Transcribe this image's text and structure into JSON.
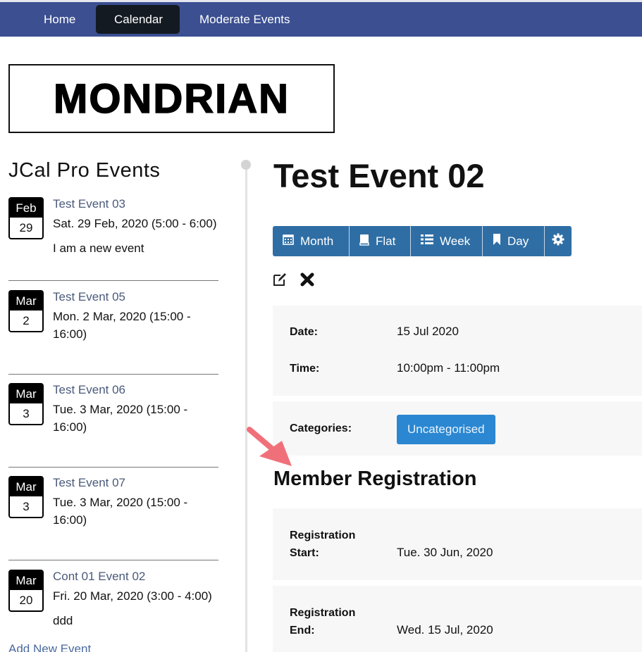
{
  "nav": {
    "items": [
      {
        "label": "Home",
        "active": false
      },
      {
        "label": "Calendar",
        "active": true
      },
      {
        "label": "Moderate Events",
        "active": false
      }
    ]
  },
  "logo": {
    "text": "MONDRIAN"
  },
  "sidebar": {
    "title": "JCal Pro Events",
    "events": [
      {
        "month": "Feb",
        "day": "29",
        "title": "Test Event 03",
        "when": "Sat. 29 Feb, 2020 (5:00 - 6:00)",
        "description": "I am a new event"
      },
      {
        "month": "Mar",
        "day": "2",
        "title": "Test Event 05",
        "when": "Mon. 2 Mar, 2020 (15:00 - 16:00)",
        "description": ""
      },
      {
        "month": "Mar",
        "day": "3",
        "title": "Test Event 06",
        "when": "Tue. 3 Mar, 2020 (15:00 - 16:00)",
        "description": ""
      },
      {
        "month": "Mar",
        "day": "3",
        "title": "Test Event 07",
        "when": "Tue. 3 Mar, 2020 (15:00 - 16:00)",
        "description": ""
      },
      {
        "month": "Mar",
        "day": "20",
        "title": "Cont 01 Event 02",
        "when": "Fri. 20 Mar, 2020 (3:00 - 4:00)",
        "description": "ddd"
      }
    ],
    "add_link": "Add New Event"
  },
  "main": {
    "title": "Test Event 02",
    "views": [
      {
        "label": "Month",
        "icon": "calendar-icon"
      },
      {
        "label": "Flat",
        "icon": "book-icon"
      },
      {
        "label": "Week",
        "icon": "list-icon"
      },
      {
        "label": "Day",
        "icon": "bookmark-icon"
      },
      {
        "label": "",
        "icon": "gear-icon"
      }
    ],
    "actions": {
      "edit": "edit-icon",
      "delete": "delete-icon"
    },
    "details": {
      "date_label": "Date:",
      "date_value": "15 Jul 2020",
      "time_label": "Time:",
      "time_value": "10:00pm - 11:00pm"
    },
    "categories": {
      "label": "Categories:",
      "value": "Uncategorised"
    },
    "registration": {
      "title": "Member Registration",
      "start_label_1": "Registration",
      "start_label_2": "Start:",
      "start_value": "Tue. 30 Jun, 2020",
      "end_label_1": "Registration",
      "end_label_2": "End:",
      "end_value": "Wed. 15 Jul, 2020"
    }
  },
  "colors": {
    "nav_bg": "#3b4f91",
    "nav_active": "#141a22",
    "button_bg": "#2f6ea4",
    "category_badge": "#2b87d1",
    "event_link": "#4a5a7a",
    "annotation_arrow": "#f0707a"
  }
}
